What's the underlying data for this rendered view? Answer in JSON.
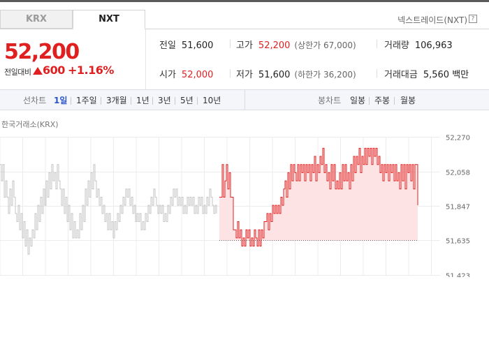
{
  "tabs": [
    {
      "label": "KRX",
      "active": false
    },
    {
      "label": "NXT",
      "active": true
    }
  ],
  "exchange_label": "넥스트레이드(NXT)",
  "help_icon": "?",
  "price": {
    "current": "52,200",
    "change_label": "전일대비",
    "change_value": "600",
    "change_pct": "+1.16%",
    "direction": "up"
  },
  "stats": {
    "prev_close": {
      "label": "전일",
      "value": "51,600"
    },
    "high": {
      "label": "고가",
      "value": "52,200",
      "limit": "(상한가 67,000)"
    },
    "volume": {
      "label": "거래량",
      "value": "106,963"
    },
    "open": {
      "label": "시가",
      "value": "52,000"
    },
    "low": {
      "label": "저가",
      "value": "51,600",
      "limit": "(하한가 36,200)"
    },
    "amount": {
      "label": "거래대금",
      "value": "5,560 백만"
    }
  },
  "period_bar": {
    "line_label": "선차트",
    "line_periods": [
      "1일",
      "1주일",
      "3개월",
      "1년",
      "3년",
      "5년",
      "10년"
    ],
    "active_period": "1일",
    "candle_label": "봉차트",
    "candle_periods": [
      "일봉",
      "주봉",
      "월봉"
    ]
  },
  "colors": {
    "up": "#e02020",
    "krx_line": "#c4c4c4",
    "nxt_line": "#e02020",
    "nxt_fill": "#fde3e3",
    "active": "#2b54c9"
  },
  "chart_data": {
    "type": "line",
    "title": "한국거래소(KRX)",
    "y_ticks": [
      "52,270",
      "52,058",
      "51,847",
      "51,635",
      "51,423"
    ],
    "ylim": [
      51423,
      52270
    ],
    "reference_line": 51635,
    "grid": true,
    "series": [
      {
        "segment": "KRX",
        "step": 2,
        "values": [
          52100,
          52000,
          52100,
          51900,
          52000,
          51900,
          51800,
          51950,
          51850,
          52000,
          51900,
          51800,
          51750,
          51850,
          51700,
          51800,
          51650,
          51750,
          51600,
          51700,
          51550,
          51650,
          51600,
          51700,
          51650,
          51800,
          51700,
          51850,
          51750,
          51900,
          51800,
          51950,
          51850,
          52000,
          51900,
          52050,
          51950,
          52100,
          52000,
          52050,
          51950,
          52100,
          52000,
          51950,
          51850,
          51950,
          51800,
          51900,
          51750,
          51850,
          51700,
          51800,
          51650,
          51750,
          51650,
          51700,
          51650,
          51800,
          51700,
          51850,
          51750,
          51950,
          51850,
          52000,
          51900,
          52050,
          51950,
          52100,
          52000,
          51900,
          51950,
          51850,
          51900,
          51800,
          51850,
          51750,
          51800,
          51700,
          51800,
          51700,
          51750,
          51650,
          51750,
          51700,
          51800,
          51750,
          51850,
          51800,
          51900,
          51850,
          51950,
          51900,
          51950,
          51850,
          51900,
          51800,
          51850,
          51750,
          51800,
          51750,
          51800,
          51700,
          51750,
          51700,
          51800,
          51750,
          51850,
          51800,
          51900,
          51850,
          51950,
          51900,
          51850,
          51800,
          51850,
          51800,
          51850,
          51750,
          51800,
          51750,
          51850,
          51800,
          51900,
          51850,
          51950,
          51900,
          51950,
          51850,
          51900,
          51850,
          51900,
          51800,
          51850,
          51800,
          51900,
          51850,
          51900,
          51850,
          51900,
          51800,
          51850,
          51800,
          51900,
          51850,
          51900,
          51800,
          51850,
          51800,
          51900,
          51850,
          51950,
          51900,
          51850,
          51800,
          51850,
          51800
        ]
      },
      {
        "segment": "NXT",
        "step": 2,
        "values": [
          51900,
          51900,
          52100,
          51900,
          52000,
          52100,
          51950,
          52050,
          51900,
          51900,
          51700,
          51700,
          51650,
          51750,
          51650,
          51700,
          51600,
          51650,
          51600,
          51700,
          51650,
          51700,
          51600,
          51650,
          51600,
          51700,
          51650,
          51600,
          51700,
          51600,
          51700,
          51650,
          51750,
          51750,
          51800,
          51700,
          51800,
          51750,
          51850,
          51800,
          51850,
          51800,
          51850,
          51800,
          51900,
          51850,
          51950,
          52000,
          51900,
          52050,
          51950,
          52100,
          52000,
          52100,
          52050,
          52000,
          52100,
          52000,
          52100,
          52050,
          52100,
          52000,
          52100,
          52050,
          52100,
          52000,
          52100,
          52050,
          52150,
          52000,
          52100,
          52050,
          52150,
          52100,
          52200,
          52050,
          52100,
          52000,
          52050,
          51950,
          52100,
          52000,
          52100,
          51950,
          52000,
          51950,
          52050,
          51950,
          52100,
          52000,
          52100,
          52000,
          52050,
          51950,
          52100,
          52000,
          52150,
          52050,
          52150,
          52100,
          52200,
          52050,
          52150,
          52100,
          52200,
          52100,
          52200,
          52150,
          52200,
          52100,
          52200,
          52150,
          52200,
          52100,
          52150,
          52050,
          52100,
          52000,
          52100,
          52050,
          52100,
          52000,
          52100,
          52050,
          52100,
          52000,
          52100,
          52000,
          52050,
          51950,
          52100,
          52000,
          52100,
          51950,
          52100,
          52050,
          52100,
          52000,
          52100,
          51950,
          52100,
          52100,
          51850
        ]
      }
    ]
  }
}
